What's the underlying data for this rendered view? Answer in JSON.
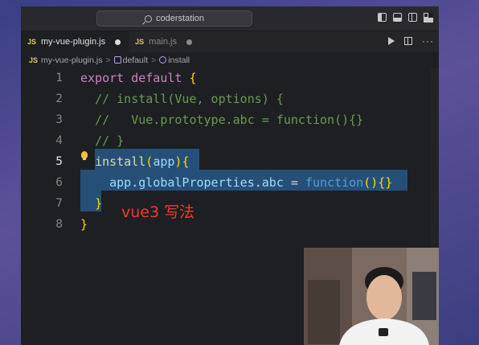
{
  "window": {
    "search_text": "coderstation"
  },
  "tabs": [
    {
      "badge": "JS",
      "label": "my-vue-plugin.js",
      "active": true,
      "dirty": true
    },
    {
      "badge": "JS",
      "label": "main.js",
      "active": false,
      "dirty": true
    }
  ],
  "breadcrumb": {
    "badge": "JS",
    "file": "my-vue-plugin.js",
    "sep1": ">",
    "symbol1": "default",
    "sep2": ">",
    "symbol2": "install"
  },
  "editor": {
    "line_numbers": [
      "1",
      "2",
      "3",
      "4",
      "5",
      "6",
      "7",
      "8"
    ],
    "current_line": "5",
    "lines": [
      [
        {
          "t": "export",
          "c": "kw"
        },
        {
          "t": " "
        },
        {
          "t": "default",
          "c": "kw"
        },
        {
          "t": " "
        },
        {
          "t": "{",
          "c": "br"
        }
      ],
      [
        {
          "t": "  "
        },
        {
          "t": "// install(Vue, options) {",
          "c": "cm"
        }
      ],
      [
        {
          "t": "  "
        },
        {
          "t": "//   Vue.prototype.abc = function(){}",
          "c": "cm"
        }
      ],
      [
        {
          "t": "  "
        },
        {
          "t": "// }",
          "c": "cm"
        }
      ],
      [
        {
          "t": "  "
        },
        {
          "t": "install",
          "c": "fn"
        },
        {
          "t": "(",
          "c": "br"
        },
        {
          "t": "app",
          "c": "var"
        },
        {
          "t": ")",
          "c": "br"
        },
        {
          "t": "{",
          "c": "br"
        }
      ],
      [
        {
          "t": "    "
        },
        {
          "t": "app",
          "c": "var"
        },
        {
          "t": "."
        },
        {
          "t": "globalProperties",
          "c": "var"
        },
        {
          "t": "."
        },
        {
          "t": "abc",
          "c": "var"
        },
        {
          "t": " = "
        },
        {
          "t": "function",
          "c": "kw2"
        },
        {
          "t": "(){}",
          "c": "br"
        }
      ],
      [
        {
          "t": "  "
        },
        {
          "t": "}",
          "c": "br"
        }
      ],
      [
        {
          "t": "}",
          "c": "br"
        }
      ]
    ]
  },
  "annotation": "vue3 写法",
  "colors": {
    "editor_bg": "#1e1f22",
    "selection": "#264f78",
    "comment": "#6a9955",
    "keyword": "#c586c0",
    "annotation": "#f03a2a"
  }
}
